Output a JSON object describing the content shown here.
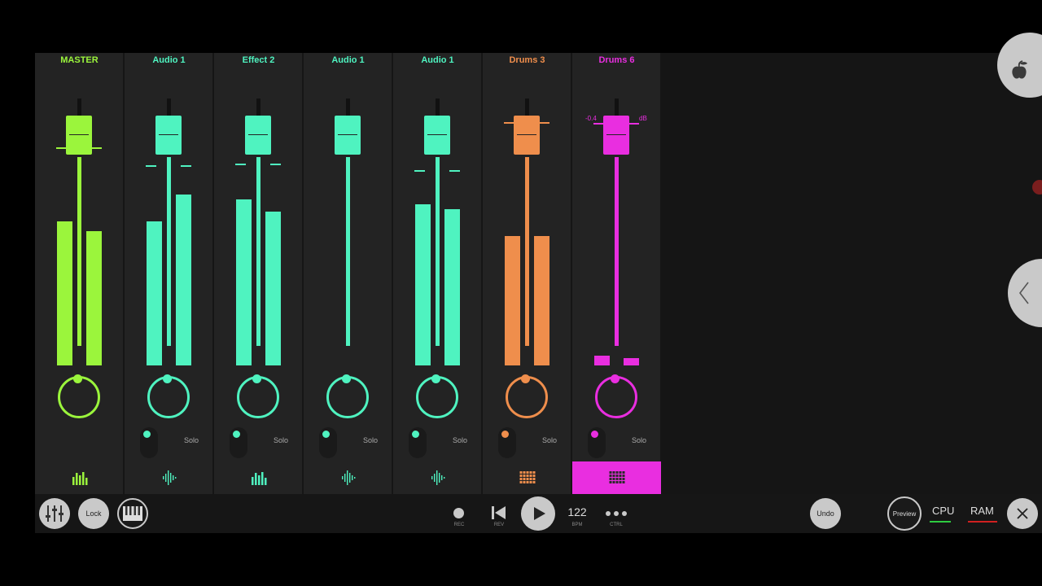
{
  "mixer": {
    "channels": [
      {
        "name": "MASTER",
        "color": "#9bf53c",
        "meters": [
          0.59,
          0.55
        ],
        "show_solo": false,
        "icon": "bars-icon"
      },
      {
        "name": "Audio 1",
        "color": "#4ff3c0",
        "meters": [
          0.59,
          0.7
        ],
        "show_solo": true,
        "solo": "Solo",
        "icon": "waveform-icon"
      },
      {
        "name": "Effect 2",
        "color": "#4ff3c0",
        "meters": [
          0.68,
          0.63
        ],
        "show_solo": true,
        "solo": "Solo",
        "icon": "bars-icon"
      },
      {
        "name": "Audio 1",
        "color": "#4ff3c0",
        "meters": [
          0,
          0
        ],
        "show_solo": true,
        "solo": "Solo",
        "icon": "waveform-icon"
      },
      {
        "name": "Audio 1",
        "color": "#4ff3c0",
        "meters": [
          0.66,
          0.64
        ],
        "show_solo": true,
        "solo": "Solo",
        "icon": "waveform-icon"
      },
      {
        "name": "Drums 3",
        "color": "#ef8e4c",
        "meters": [
          0.53,
          0.53
        ],
        "show_solo": true,
        "solo": "Solo",
        "icon": "grid-icon"
      },
      {
        "name": "Drums 6",
        "color": "#e92ee0",
        "meters": [
          0.04,
          0.03
        ],
        "show_solo": true,
        "solo": "Solo",
        "icon": "grid-icon",
        "selected": true,
        "db_value": "-0.4",
        "db_unit": "dB"
      }
    ]
  },
  "toolbar": {
    "lock_label": "Lock",
    "rec_label": "REC",
    "rev_label": "REV",
    "bpm_value": "122",
    "bpm_label": "BPM",
    "ctrl_label": "CTRL",
    "undo_label": "Undo",
    "preview_label": "Preview",
    "cpu_label": "CPU",
    "ram_label": "RAM",
    "cpu_color": "#2ecc40",
    "ram_color": "#d02020"
  },
  "icons": {
    "mixer": "mixer-sliders-icon",
    "piano": "piano-icon",
    "rec": "record-icon",
    "rev": "skip-back-icon",
    "play": "play-icon",
    "ctrl": "more-dots-icon",
    "close": "close-icon",
    "logo": "fruit-logo-icon",
    "collapse": "chevron-left-icon"
  }
}
